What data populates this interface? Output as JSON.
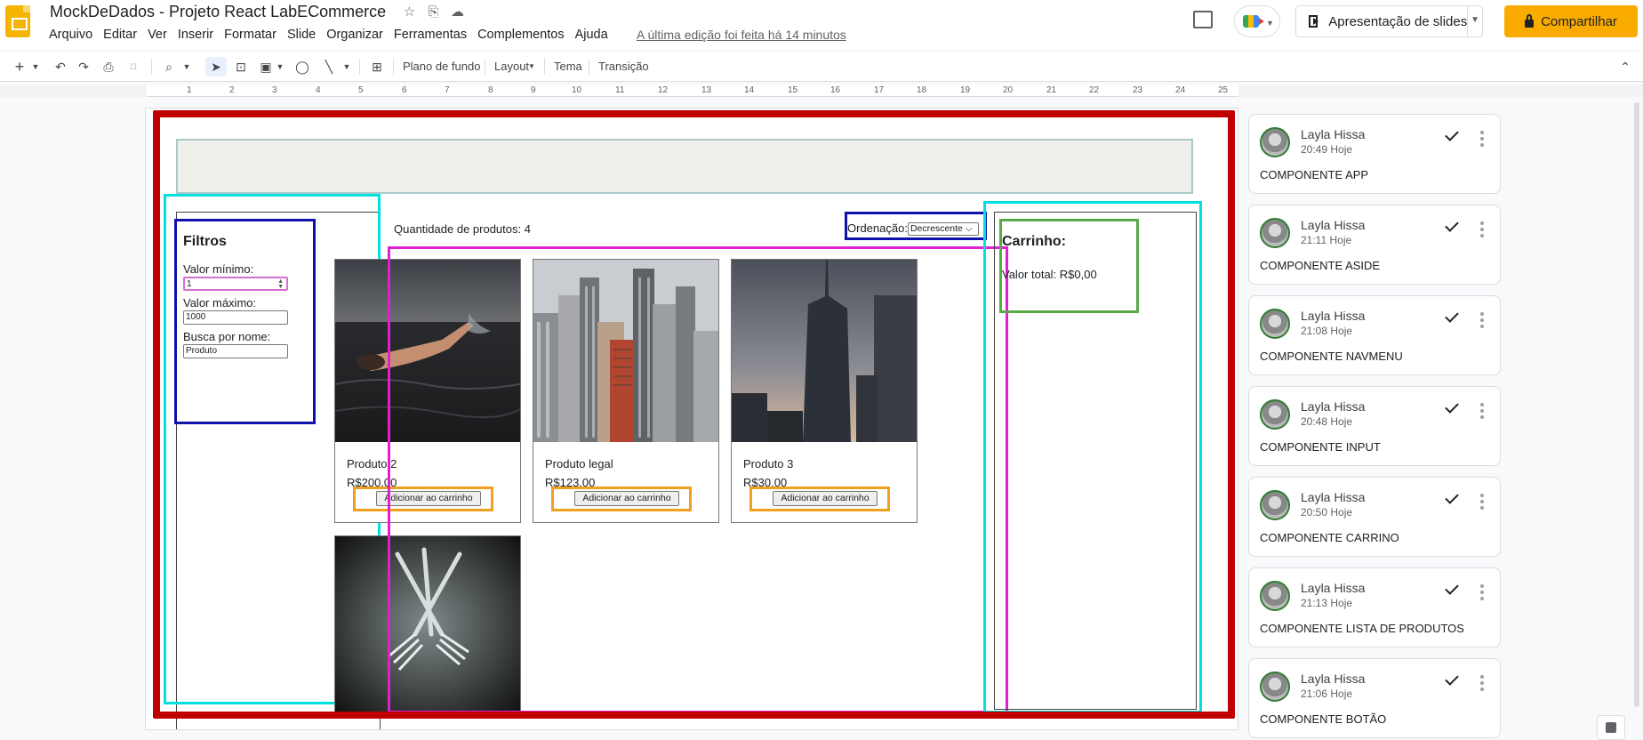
{
  "header": {
    "doc_title": "MockDeDados - Projeto React LabECommerce",
    "menu": [
      "Arquivo",
      "Editar",
      "Ver",
      "Inserir",
      "Formatar",
      "Slide",
      "Organizar",
      "Ferramentas",
      "Complementos",
      "Ajuda"
    ],
    "last_edit": "A última edição foi feita há 14 minutos",
    "present_label": "Apresentação de slides",
    "share_label": "Compartilhar"
  },
  "toolbar": {
    "background": "Plano de fundo",
    "layout": "Layout",
    "theme": "Tema",
    "transition": "Transição"
  },
  "ruler": [
    "1",
    "2",
    "3",
    "4",
    "5",
    "6",
    "7",
    "8",
    "9",
    "10",
    "11",
    "12",
    "13",
    "14",
    "15",
    "16",
    "17",
    "18",
    "19",
    "20",
    "21",
    "22",
    "23",
    "24",
    "25"
  ],
  "slide": {
    "filters_title": "Filtros",
    "min_label": "Valor mínimo:",
    "min_value": "1",
    "max_label": "Valor máximo:",
    "max_value": "1000",
    "name_label": "Busca por nome:",
    "name_value": "Produto",
    "qtd_label": "Quantidade de produtos: 4",
    "order_label": "Ordenação:",
    "order_value": "Decrescente",
    "add_label": "Adicionar ao carrinho",
    "products": [
      {
        "name": "Produto 2",
        "price": "R$200,00"
      },
      {
        "name": "Produto legal",
        "price": "R$123,00"
      },
      {
        "name": "Produto 3",
        "price": "R$30,00"
      }
    ],
    "cart_title": "Carrinho:",
    "cart_total": "Valor total: R$0,00"
  },
  "comments": [
    {
      "name": "Layla Hissa",
      "time": "20:49 Hoje",
      "text": "COMPONENTE APP"
    },
    {
      "name": "Layla Hissa",
      "time": "21:11 Hoje",
      "text": "COMPONENTE ASIDE"
    },
    {
      "name": "Layla Hissa",
      "time": "21:08 Hoje",
      "text": "COMPONENTE NAVMENU"
    },
    {
      "name": "Layla Hissa",
      "time": "20:48 Hoje",
      "text": "COMPONENTE INPUT"
    },
    {
      "name": "Layla Hissa",
      "time": "20:50 Hoje",
      "text": "COMPONENTE CARRINO"
    },
    {
      "name": "Layla Hissa",
      "time": "21:13 Hoje",
      "text": "COMPONENTE LISTA DE PRODUTOS"
    },
    {
      "name": "Layla Hissa",
      "time": "21:06 Hoje",
      "text": "COMPONENTE BOTÃO"
    }
  ],
  "colors": {
    "share": "#f9ab00",
    "frame_red": "#c00000",
    "cyan": "#00e0e0",
    "navy": "#1010aa",
    "magenta": "#e020d0",
    "orange": "#f0a020",
    "green": "#5aa84a"
  }
}
